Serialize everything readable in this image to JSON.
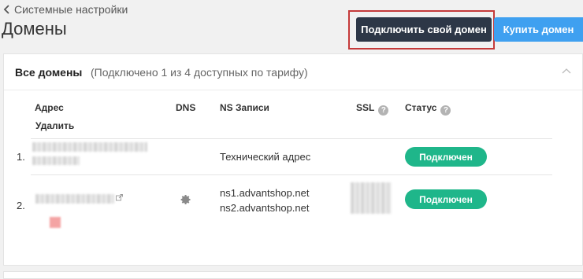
{
  "breadcrumb": {
    "label": "Системные настройки"
  },
  "page_title": "Домены",
  "buttons": {
    "connect_domain": "Подключить свой домен",
    "buy_domain": "Купить домен"
  },
  "card": {
    "title": "Все домены",
    "subtitle": "(Подключено 1 из 4 доступных по тарифу)"
  },
  "table": {
    "columns": {
      "address": "Адрес",
      "delete": "Удалить",
      "dns": "DNS",
      "ns_records": "NS Записи",
      "ssl": "SSL",
      "status": "Статус"
    },
    "rows": [
      {
        "index": "1.",
        "ns_records": "Технический адрес",
        "status": "Подключен"
      },
      {
        "index": "2.",
        "ns1": "ns1.advantshop.net",
        "ns2": "ns2.advantshop.net",
        "status": "Подключен"
      }
    ]
  },
  "colors": {
    "primary_dark": "#2d3747",
    "primary_blue": "#3fa0f0",
    "status_green": "#1fb68a",
    "highlight_red": "#c53a3a"
  },
  "icons": {
    "back": "chevron-left-icon",
    "collapse": "chevron-up-icon",
    "help": "question-circle-icon",
    "settings": "gear-icon",
    "external": "external-link-icon"
  }
}
